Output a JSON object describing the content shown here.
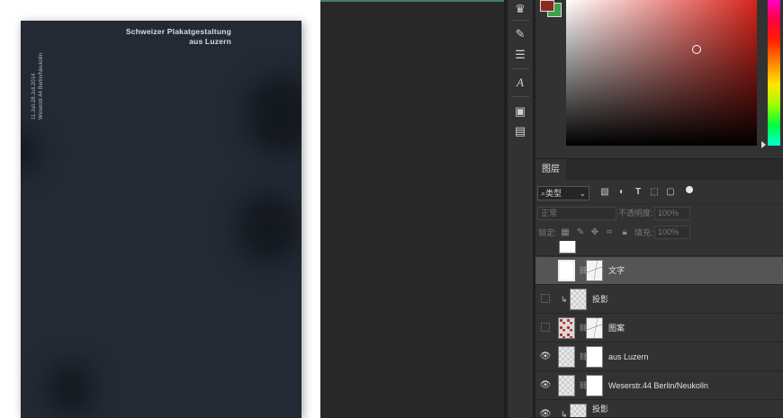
{
  "poster": {
    "title_line1": "Schweizer Plakatgestaltung",
    "title_line2": "aus Luzern",
    "vertical_line1": "11.Juli-28.Juli.2014",
    "vertical_line2": "Weserstr.44 Berlin/Neukolln"
  },
  "colors": {
    "foreground": "#8c2a22",
    "background": "#3fa14a",
    "canvas_bg": "#232a34"
  },
  "tools": [
    {
      "icon": "crown-tool-icon",
      "glyph": "♛"
    },
    {
      "icon": "brush-icon",
      "glyph": "✎"
    },
    {
      "icon": "sliders-icon",
      "glyph": "☰"
    },
    {
      "icon": "glyph-icon",
      "glyph": "A"
    },
    {
      "icon": "properties-icon",
      "glyph": "▣"
    },
    {
      "icon": "notes-icon",
      "glyph": "▤"
    }
  ],
  "layers_panel": {
    "tab_label": "图层",
    "filter_label": "类型",
    "blend_mode": "正常",
    "opacity_label": "不透明度:",
    "opacity_value": "100%",
    "lock_label": "锁定:",
    "fill_label": "填充:",
    "fill_value": "100%",
    "layers": [
      {
        "name": "",
        "visible": false,
        "partial": true
      },
      {
        "name": "文字",
        "visible": false,
        "selected": true
      },
      {
        "name": "投影",
        "visible": false,
        "effect": true
      },
      {
        "name": "图案",
        "visible": false
      },
      {
        "name": "aus Luzern",
        "visible": true
      },
      {
        "name": "Weserstr.44 Berlin/Neukolln",
        "visible": true
      },
      {
        "name": "投影",
        "visible": true,
        "effect": true
      }
    ]
  }
}
